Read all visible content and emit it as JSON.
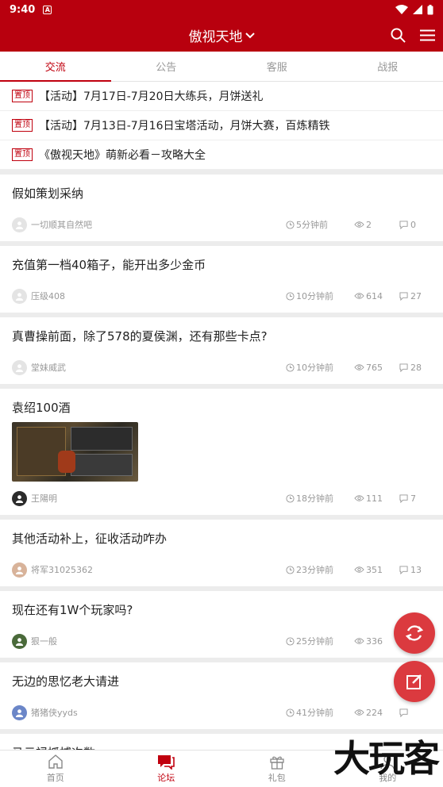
{
  "status_bar": {
    "time": "9:40",
    "notif_badge": "A"
  },
  "app_bar": {
    "title": "傲视天地"
  },
  "tabs": [
    {
      "label": "交流",
      "active": true
    },
    {
      "label": "公告",
      "active": false
    },
    {
      "label": "客服",
      "active": false
    },
    {
      "label": "战报",
      "active": false
    }
  ],
  "pinned": [
    {
      "tag": "置顶",
      "text": "【活动】7月17日-7月20日大练兵，月饼送礼"
    },
    {
      "tag": "置顶",
      "text": "【活动】7月13日-7月16日宝塔活动，月饼大赛，百炼精铁"
    },
    {
      "tag": "置顶",
      "text": "《傲视天地》萌新必看－攻略大全"
    }
  ],
  "posts": [
    {
      "title": "假如策划采纳",
      "user": "一切顺其自然吧",
      "time": "5分钟前",
      "views": "2",
      "comments": "0"
    },
    {
      "title": "充值第一档40箱子，能开出多少金币",
      "user": "压级408",
      "time": "10分钟前",
      "views": "614",
      "comments": "27"
    },
    {
      "title": "真曹操前面，除了578的夏侯渊，还有那些卡点?",
      "user": "堂妹威武",
      "time": "10分钟前",
      "views": "765",
      "comments": "28"
    },
    {
      "title": "袁绍100酒",
      "user": "王陽明",
      "time": "18分钟前",
      "views": "111",
      "comments": "7"
    },
    {
      "title": "其他活动补上，征收活动咋办",
      "user": "将军31025362",
      "time": "23分钟前",
      "views": "351",
      "comments": "13"
    },
    {
      "title": "现在还有1W个玩家吗?",
      "user": "狠一般",
      "time": "25分钟前",
      "views": "336",
      "comments": ""
    },
    {
      "title": "无边的思忆老大请进",
      "user": "猪猪侠yyds",
      "time": "41分钟前",
      "views": "224",
      "comments": ""
    },
    {
      "title": "马云禄抓捕次数",
      "user": "",
      "time": "",
      "views": "",
      "comments": ""
    }
  ],
  "bottom_nav": [
    {
      "label": "首页",
      "active": false
    },
    {
      "label": "论坛",
      "active": true
    },
    {
      "label": "礼包",
      "active": false
    },
    {
      "label": "我的",
      "active": false
    }
  ],
  "watermark": "大玩客",
  "colors": {
    "brand_red": "#b8000e",
    "accent_red": "#c0000e",
    "fab_red": "#db3a3f"
  }
}
